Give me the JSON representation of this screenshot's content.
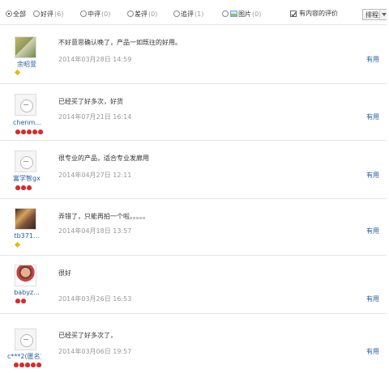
{
  "filters": [
    {
      "label": "全部",
      "count": "",
      "checked": true
    },
    {
      "label": "好评",
      "count": "(6)",
      "checked": false
    },
    {
      "label": "中评",
      "count": "(0)",
      "checked": false
    },
    {
      "label": "差评",
      "count": "(0)",
      "checked": false
    },
    {
      "label": "追评",
      "count": "(1)",
      "checked": false
    },
    {
      "label": "图片",
      "count": "(0)",
      "checked": false
    }
  ],
  "content_filter": {
    "label": "有内容的评价",
    "checked": true
  },
  "sort": {
    "label": "排程排序"
  },
  "reviews": [
    {
      "user": "余昭萱",
      "text": "不好意思确认晚了，产品一如既往的好用。",
      "date": "2014年03月28日 14:59",
      "helpful": "有用"
    },
    {
      "user": "chenm...",
      "text": "已经买了好多次，好货",
      "date": "2014年07月21日 16:14",
      "helpful": "有用"
    },
    {
      "user": "富学智gxz",
      "text": "很专业的产品，适合专业发廊用",
      "date": "2014年04月27日 12:11",
      "helpful": "有用"
    },
    {
      "user": "tb371...",
      "text": "弄错了，只能再拍一个啦。。。。。",
      "date": "2014年04月18日 13:57",
      "helpful": "有用"
    },
    {
      "user": "babyz...",
      "text": "很好",
      "date": "2014年03月26日 16:53",
      "helpful": "有用"
    },
    {
      "user": "c***2(匿名)",
      "text": "已经买了好多次了，",
      "date": "2014年03月06日 19:57",
      "helpful": "有用"
    }
  ]
}
